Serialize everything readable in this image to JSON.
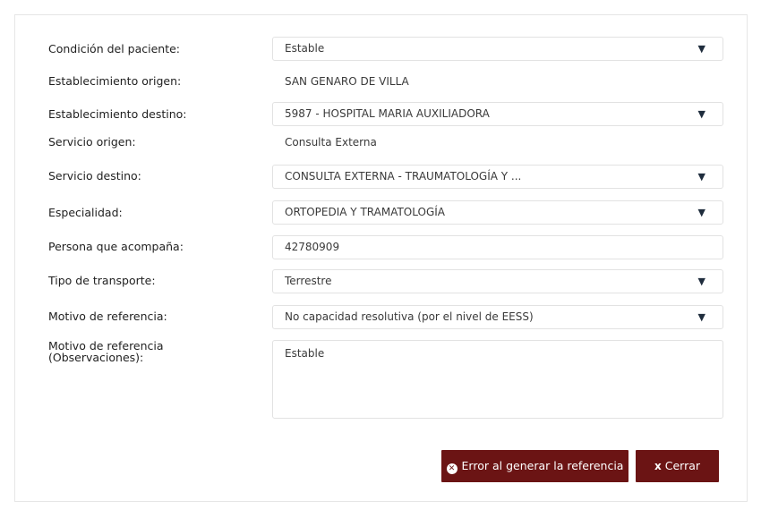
{
  "form": {
    "condicion": {
      "label": "Condición del paciente:",
      "value": "Estable"
    },
    "est_origen": {
      "label": "Establecimiento origen:",
      "value": "SAN GENARO DE VILLA"
    },
    "est_destino": {
      "label": "Establecimiento destino:",
      "value": "5987 - HOSPITAL MARIA AUXILIADORA"
    },
    "serv_origen": {
      "label": "Servicio origen:",
      "value": "Consulta Externa"
    },
    "serv_destino": {
      "label": "Servicio destino:",
      "value": "CONSULTA EXTERNA - TRAUMATOLOGÍA Y  ..."
    },
    "especialidad": {
      "label": "Especialidad:",
      "value": "ORTOPEDIA Y TRAMATOLOGÍA"
    },
    "acompana": {
      "label": "Persona que acompaña:",
      "value": "42780909"
    },
    "transporte": {
      "label": "Tipo de transporte:",
      "value": "Terrestre"
    },
    "motivo": {
      "label": "Motivo de referencia:",
      "value": "No capacidad resolutiva (por el nivel de EESS)"
    },
    "observaciones": {
      "label_line1": "Motivo de referencia",
      "label_line2": "(Observaciones):",
      "value": "Estable"
    }
  },
  "dropdown_arrow": "▼",
  "buttons": {
    "error_icon": "x-circle-icon",
    "error_label": "Error al generar la referencia",
    "close_icon": "x-icon",
    "close_label": "Cerrar"
  },
  "colors": {
    "button_bg": "#6b1414",
    "border": "#e2e2e2"
  }
}
